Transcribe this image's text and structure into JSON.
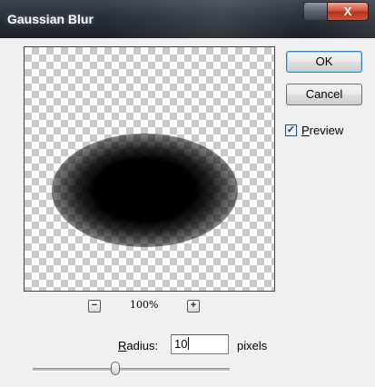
{
  "window": {
    "title": "Gaussian Blur",
    "close_glyph": "X"
  },
  "buttons": {
    "ok_label": "OK",
    "cancel_label": "Cancel"
  },
  "preview_option": {
    "checked": true,
    "check_glyph": "✓",
    "label_first": "P",
    "label_rest": "review"
  },
  "zoom": {
    "level": "100%",
    "minus_glyph": "−",
    "plus_glyph": "+"
  },
  "radius": {
    "label_first": "R",
    "label_rest": "adius:",
    "value": "10",
    "units": "pixels",
    "slider_fraction": 0.42
  },
  "colors": {
    "ok_button_border": "#3c7fb1",
    "close_button": "#c9563a"
  }
}
